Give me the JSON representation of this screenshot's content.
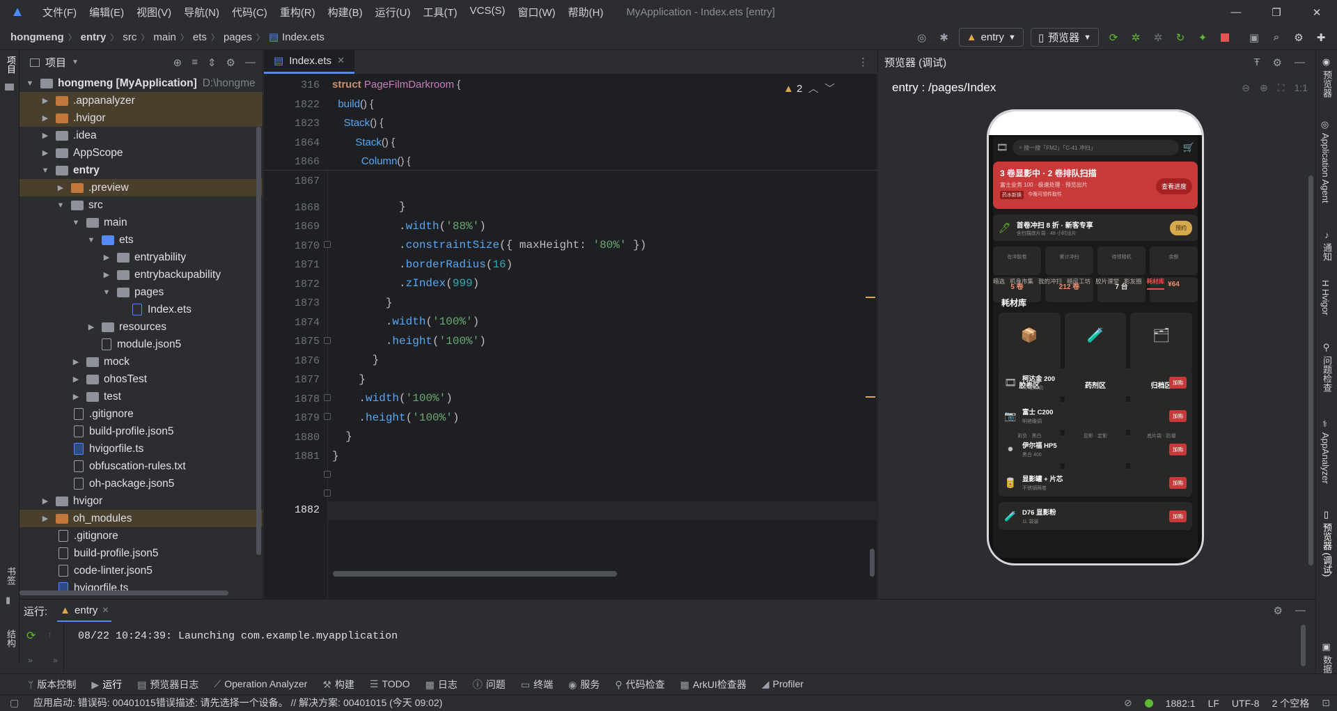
{
  "menubar": {
    "items": [
      "文件(F)",
      "编辑(E)",
      "视图(V)",
      "导航(N)",
      "代码(C)",
      "重构(R)",
      "构建(B)",
      "运行(U)",
      "工具(T)",
      "VCS(S)",
      "窗口(W)",
      "帮助(H)"
    ],
    "title": "MyApplication - Index.ets [entry]"
  },
  "breadcrumb": [
    "hongmeng",
    "entry",
    "src",
    "main",
    "ets",
    "pages",
    "Index.ets"
  ],
  "toolbar": {
    "run_config": "entry",
    "previewer": "预览器"
  },
  "project": {
    "header": "项目",
    "root_name": "hongmeng",
    "root_module": "[MyApplication]",
    "root_path": "D:\\hongme",
    "nodes": [
      {
        "label": ".appanalyzer"
      },
      {
        "label": ".hvigor"
      },
      {
        "label": ".idea"
      },
      {
        "label": "AppScope"
      },
      {
        "label": "entry"
      },
      {
        "label": ".preview"
      },
      {
        "label": "src"
      },
      {
        "label": "main"
      },
      {
        "label": "ets"
      },
      {
        "label": "entryability"
      },
      {
        "label": "entrybackupability"
      },
      {
        "label": "pages"
      },
      {
        "label": "Index.ets"
      },
      {
        "label": "resources"
      },
      {
        "label": "module.json5"
      },
      {
        "label": "mock"
      },
      {
        "label": "ohosTest"
      },
      {
        "label": "test"
      },
      {
        "label": ".gitignore"
      },
      {
        "label": "build-profile.json5"
      },
      {
        "label": "hvigorfile.ts"
      },
      {
        "label": "obfuscation-rules.txt"
      },
      {
        "label": "oh-package.json5"
      },
      {
        "label": "hvigor"
      },
      {
        "label": "oh_modules"
      },
      {
        "label": ".gitignore"
      },
      {
        "label": "build-profile.json5"
      },
      {
        "label": "code-linter.json5"
      },
      {
        "label": "hvigorfile.ts"
      }
    ]
  },
  "editor": {
    "tab": "Index.ets",
    "warnings": "2",
    "sticky_lines": [
      "316",
      "1822",
      "1823",
      "1864",
      "1866"
    ],
    "lines": [
      "1867",
      "1868",
      "1869",
      "1870",
      "1871",
      "1872",
      "1873",
      "1874",
      "1875",
      "1876",
      "1877",
      "1878",
      "1879",
      "1880",
      "1881",
      "1882"
    ]
  },
  "preview": {
    "header": "预览器 (调试)",
    "route": "entry : /pages/Index",
    "zoom": "1:1",
    "phone": {
      "search_placeholder": "搜一搜「FM2」「C-41 冲扫」",
      "banner_title": "3 卷显影中 · 2 卷排队扫描",
      "banner_sub": "富士业务 100 · 极速处理 · 预览出片",
      "banner_tag1": "药水新换",
      "banner_tag2": "今晚可领件取件",
      "banner_button": "查看进度",
      "promo_title": "首卷冲扫 8 折 · 新客专享",
      "promo_sub": "含扫描底片袋 · 48 小时出片",
      "promo_button": "预约",
      "stats": [
        {
          "k": "在冲胶卷",
          "v": "5 卷"
        },
        {
          "k": "累计冲扫",
          "v": "212 卷"
        },
        {
          "k": "待领相机",
          "v": "7 台"
        },
        {
          "k": "余额",
          "v": "¥64"
        }
      ],
      "tabs": [
        "暗选",
        "机身市集",
        "我的冲扫",
        "暗房工坊",
        "胶片课堂",
        "影友圈",
        "耗材库"
      ],
      "section": "耗材库",
      "cats": [
        {
          "icon": "📦",
          "name": "胶卷区",
          "desc": "彩负 · 黑白"
        },
        {
          "icon": "🧪",
          "name": "药剂区",
          "desc": "显影 · 定影"
        },
        {
          "icon": "🗂",
          "name": "归档区",
          "desc": "底片袋 · 防潮"
        }
      ],
      "items": [
        {
          "icon": "🎞",
          "name": "柯达金 200",
          "desc": "36 张彩负",
          "btn": "加购"
        },
        {
          "icon": "📷",
          "name": "富士 C200",
          "desc": "明艳暖调",
          "btn": "加购"
        },
        {
          "icon": "⚫",
          "name": "伊尔福 HP5",
          "desc": "黑白 400",
          "btn": "加购"
        },
        {
          "icon": "🥫",
          "name": "显影罐 + 片芯",
          "desc": "不锈钢两卷",
          "btn": "加购"
        },
        {
          "icon": "🧪",
          "name": "D76 显影粉",
          "desc": "1L 袋装",
          "btn": "加购"
        }
      ]
    }
  },
  "right_strip": [
    "预览器",
    "Application Agent",
    "通知",
    "Hvigor",
    "问题检查",
    "AppAnalyzer",
    "预览器 (调试)",
    "数据库检查"
  ],
  "left_strip": [
    "项目",
    "书签",
    "结构"
  ],
  "run": {
    "label": "运行:",
    "tab": "entry",
    "output": "08/22 10:24:39: Launching com.example.myapplication"
  },
  "toolwindows": [
    "版本控制",
    "运行",
    "预览器日志",
    "Operation Analyzer",
    "构建",
    "TODO",
    "日志",
    "问题",
    "终端",
    "服务",
    "代码检查",
    "ArkUI检查器",
    "Profiler"
  ],
  "status": {
    "message": "应用启动: 错误码: 00401015错误描述: 请先选择一个设备。 // 解决方案: 00401015 (今天 09:02)",
    "position": "1882:1",
    "eol": "LF",
    "encoding": "UTF-8",
    "indent": "2 个空格"
  },
  "colors": {
    "accent": "#548af7",
    "warning": "#e0a84a",
    "banner": "#c83a3a"
  }
}
